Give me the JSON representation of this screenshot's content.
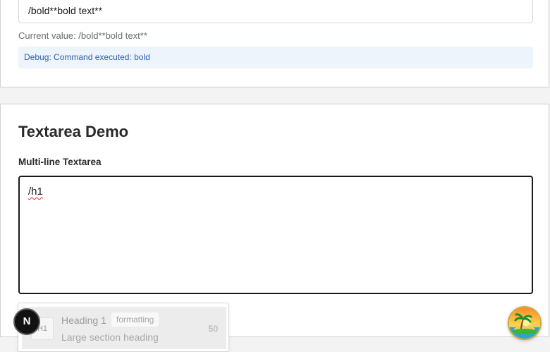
{
  "input_demo": {
    "input_value": "/bold**bold text**",
    "current_value_label": "Current value: /bold**bold text**",
    "debug_text": "Debug: Command executed: bold"
  },
  "textarea_demo": {
    "title": "Textarea Demo",
    "field_label": "Multi-line Textarea",
    "textarea_value": "/h1"
  },
  "command_menu": {
    "items": [
      {
        "icon_text": "H1",
        "title": "Heading 1",
        "tag": "formatting",
        "description": "Large section heading",
        "score": "50"
      }
    ]
  },
  "overlays": {
    "nextjs_badge": "N",
    "island_icon": "palm-island-icon"
  },
  "colors": {
    "debug_background": "#eef4fb",
    "debug_text": "#2f5fa8",
    "textarea_border": "#1a1a1a",
    "spellcheck_underline": "#e0312d"
  }
}
